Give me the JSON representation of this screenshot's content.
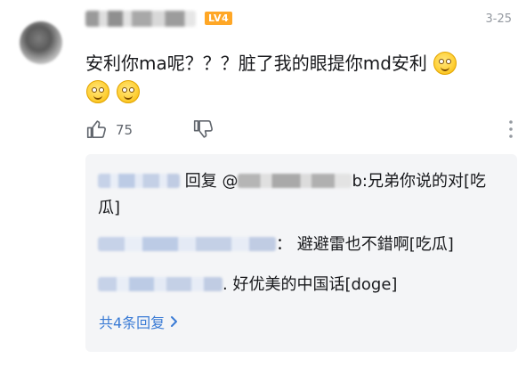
{
  "comment": {
    "level_badge": "LV4",
    "time": "3-25",
    "text": "安利你ma呢？？？脏了我的眼提你md安利",
    "like_count": "75"
  },
  "replies": [
    {
      "prefix": "回复 @",
      "middle": "b",
      "text": ":兄弟你说的对[吃瓜]"
    },
    {
      "text": "： 避避雷也不錯啊[吃瓜]"
    },
    {
      "text": ". 好优美的中国话[doge]"
    }
  ],
  "more_replies": "共4条回复",
  "colors": {
    "level_badge": "#ffa726",
    "link": "#3a7bd5",
    "reply_bg": "#f4f5f7",
    "meta_text": "#9499a0"
  },
  "icons": [
    "like-icon",
    "dislike-icon",
    "more-icon",
    "chevron-right-icon",
    "smile-emoji"
  ]
}
